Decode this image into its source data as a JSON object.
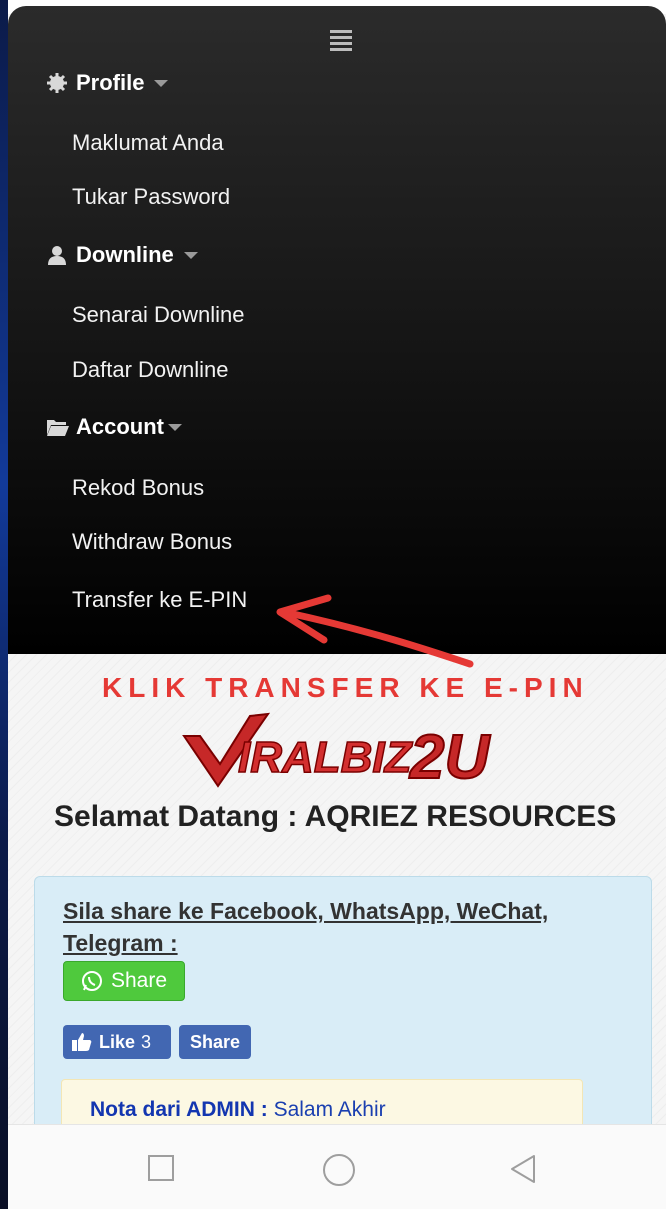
{
  "menu": {
    "sections": [
      {
        "title": "Profile",
        "icon": "gear-icon",
        "items": [
          "Maklumat Anda",
          "Tukar Password"
        ]
      },
      {
        "title": "Downline",
        "icon": "user-icon",
        "items": [
          "Senarai Downline",
          "Daftar Downline"
        ]
      },
      {
        "title": "Account",
        "icon": "folder-open-icon",
        "items": [
          "Rekod Bonus",
          "Withdraw Bonus",
          "Transfer ke E-PIN"
        ]
      }
    ]
  },
  "annotation": {
    "text": "KLIK TRANSFER KE E-PIN",
    "color": "#e53935"
  },
  "logo": {
    "text": "VIRALBIZ2U",
    "color": "#c62828"
  },
  "welcome": "Selamat Datang : AQRIEZ RESOURCES",
  "share_panel": {
    "text": "Sila share ke Facebook, WhatsApp, WeChat, Telegram :",
    "whatsapp_label": "Share",
    "fb_like_label": "Like",
    "fb_like_count": "3",
    "fb_share_label": "Share"
  },
  "nota": {
    "label": "Nota dari ADMIN :",
    "message": "Salam Akhir"
  },
  "navbar": {
    "buttons": [
      "recent-apps",
      "home",
      "back"
    ]
  }
}
